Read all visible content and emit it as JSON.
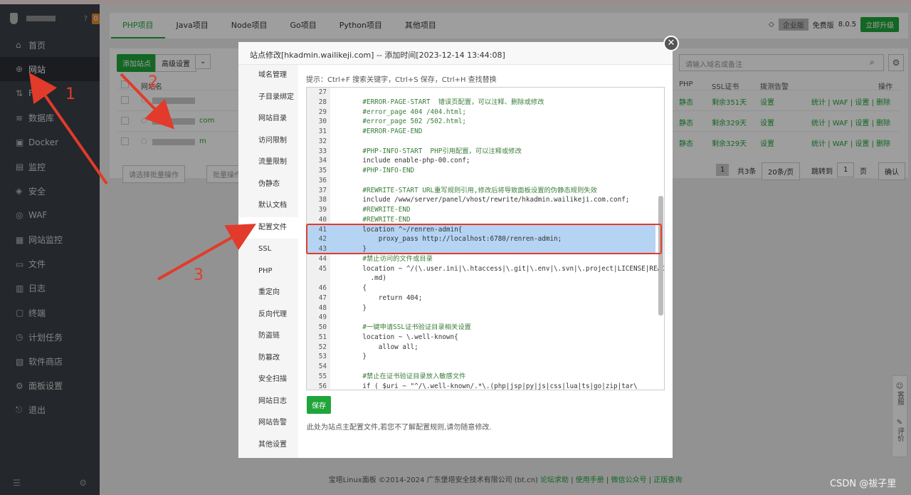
{
  "sidebar": {
    "badge": "0",
    "items": [
      {
        "label": "首页",
        "icon": "home-icon",
        "glyph": "⌂"
      },
      {
        "label": "网站",
        "icon": "globe-icon",
        "glyph": "⊕"
      },
      {
        "label": "FTP",
        "icon": "ftp-icon",
        "glyph": "⇅"
      },
      {
        "label": "数据库",
        "icon": "database-icon",
        "glyph": "≋"
      },
      {
        "label": "Docker",
        "icon": "docker-icon",
        "glyph": "▣"
      },
      {
        "label": "监控",
        "icon": "monitor-icon",
        "glyph": "▤"
      },
      {
        "label": "安全",
        "icon": "shield-icon",
        "glyph": "◈"
      },
      {
        "label": "WAF",
        "icon": "waf-icon",
        "glyph": "◎"
      },
      {
        "label": "网站监控",
        "icon": "site-monitor-icon",
        "glyph": "▦"
      },
      {
        "label": "文件",
        "icon": "folder-icon",
        "glyph": "▭"
      },
      {
        "label": "日志",
        "icon": "log-icon",
        "glyph": "▥"
      },
      {
        "label": "终端",
        "icon": "terminal-icon",
        "glyph": "▢"
      },
      {
        "label": "计划任务",
        "icon": "clock-icon",
        "glyph": "◷"
      },
      {
        "label": "软件商店",
        "icon": "store-icon",
        "glyph": "▧"
      },
      {
        "label": "面板设置",
        "icon": "settings-icon",
        "glyph": "⚙"
      },
      {
        "label": "退出",
        "icon": "logout-icon",
        "glyph": "⎋"
      }
    ],
    "active_index": 1
  },
  "tabs": [
    "PHP项目",
    "Java项目",
    "Node项目",
    "Go项目",
    "Python项目",
    "其他项目"
  ],
  "header_right": {
    "edition": "企业版",
    "free": "免费版",
    "version": "8.0.5",
    "upgrade": "立即升级"
  },
  "toolbar": {
    "add_site": "添加站点",
    "advanced": "高级设置",
    "search_placeholder": "请输入域名或备注"
  },
  "table": {
    "headers": {
      "site": "网站名",
      "php": "PHP",
      "ssl": "SSL证书",
      "alert": "拨测告警",
      "ops": "操作"
    },
    "rows": [
      {
        "name": "",
        "php": "静态",
        "ssl": "剩余351天",
        "alert": "设置",
        "ops": "统计 | WAF | 设置 | 删除"
      },
      {
        "name": "com",
        "php": "静态",
        "ssl": "剩余329天",
        "alert": "设置",
        "ops": "统计 | WAF | 设置 | 删除"
      },
      {
        "name": "m",
        "php": "静态",
        "ssl": "剩余329天",
        "alert": "设置",
        "ops": "统计 | WAF | 设置 | 删除"
      }
    ],
    "batch1": "请选择批量操作",
    "batch2": "批量操作"
  },
  "pager": {
    "page": "1",
    "total": "共3条",
    "per_page": "20条/页",
    "jump": "跳转到",
    "page_input": "1",
    "page_unit": "页",
    "confirm": "确认"
  },
  "footer": {
    "copyright": "宝塔Linux面板 ©2014-2024 广东堡塔安全技术有限公司 (bt.cn)",
    "links": [
      "论坛求助",
      "使用手册",
      "微信公众号",
      "正版查询"
    ]
  },
  "float": {
    "service": "客服",
    "review": "评价"
  },
  "modal": {
    "title": "站点修改[hkadmin.wailikeji.com] -- 添加时间[2023-12-14 13:44:08]",
    "nav": [
      "域名管理",
      "子目录绑定",
      "网站目录",
      "访问限制",
      "流量限制",
      "伪静态",
      "默认文档",
      "配置文件",
      "SSL",
      "PHP",
      "重定向",
      "反向代理",
      "防盗链",
      "防篡改",
      "安全扫描",
      "网站日志",
      "网站告警",
      "其他设置"
    ],
    "nav_active": 7,
    "tip": "提示：Ctrl+F 搜索关键字，Ctrl+S 保存，Ctrl+H 查找替换",
    "code": [
      {
        "n": "27",
        "t": "",
        "c": ""
      },
      {
        "n": "28",
        "t": "    #ERROR-PAGE-START  错误页配置，可以注释、删除或修改",
        "c": "cm"
      },
      {
        "n": "29",
        "t": "    #error_page 404 /404.html;",
        "c": "cm"
      },
      {
        "n": "30",
        "t": "    #error_page 502 /502.html;",
        "c": "cm"
      },
      {
        "n": "31",
        "t": "    #ERROR-PAGE-END",
        "c": "cm"
      },
      {
        "n": "32",
        "t": "",
        "c": ""
      },
      {
        "n": "33",
        "t": "    #PHP-INFO-START  PHP引用配置，可以注释或修改",
        "c": "cm"
      },
      {
        "n": "34",
        "t": "    include enable-php-00.conf;",
        "c": ""
      },
      {
        "n": "35",
        "t": "    #PHP-INFO-END",
        "c": "cm"
      },
      {
        "n": "36",
        "t": "",
        "c": ""
      },
      {
        "n": "37",
        "t": "    #REWRITE-START URL重写规则引用,修改后将导致面板设置的伪静态规则失效",
        "c": "cm"
      },
      {
        "n": "38",
        "t": "    include /www/server/panel/vhost/rewrite/hkadmin.wailikeji.com.conf;",
        "c": ""
      },
      {
        "n": "39",
        "t": "    #REWRITE-END",
        "c": "cm"
      },
      {
        "n": "40",
        "t": "    #REWRITE-END",
        "c": "cm"
      },
      {
        "n": "41",
        "t": "    location ^~/renren-admin{",
        "c": "hl"
      },
      {
        "n": "42",
        "t": "        proxy_pass http://localhost:6780/renren-admin;",
        "c": "hl"
      },
      {
        "n": "43",
        "t": "    }",
        "c": "hl"
      },
      {
        "n": "44",
        "t": "    #禁止访问的文件或目录",
        "c": "cm"
      },
      {
        "n": "45",
        "t": "    location ~ ^/(\\.user.ini|\\.htaccess|\\.git|\\.env|\\.svn|\\.project|LICENSE|README",
        "c": ""
      },
      {
        "n": "",
        "t": "      .md)",
        "c": ""
      },
      {
        "n": "46",
        "t": "    {",
        "c": ""
      },
      {
        "n": "47",
        "t": "        return 404;",
        "c": ""
      },
      {
        "n": "48",
        "t": "    }",
        "c": ""
      },
      {
        "n": "49",
        "t": "",
        "c": ""
      },
      {
        "n": "50",
        "t": "    #一键申请SSL证书验证目录相关设置",
        "c": "cm"
      },
      {
        "n": "51",
        "t": "    location ~ \\.well-known{",
        "c": ""
      },
      {
        "n": "52",
        "t": "        allow all;",
        "c": ""
      },
      {
        "n": "53",
        "t": "    }",
        "c": ""
      },
      {
        "n": "54",
        "t": "",
        "c": ""
      },
      {
        "n": "55",
        "t": "    #禁止在证书验证目录放入敏感文件",
        "c": "cm"
      },
      {
        "n": "56",
        "t": "    if ( $uri ~ \"^/\\.well-known/.*\\.(php|jsp|py|js|css|lua|ts|go|zip|tar\\",
        "c": ""
      }
    ],
    "save": "保存",
    "note": "此处为站点主配置文件,若您不了解配置规则,请勿随意修改."
  },
  "annotations": [
    "1",
    "2",
    "3"
  ],
  "watermark": "CSDN @祓子里"
}
